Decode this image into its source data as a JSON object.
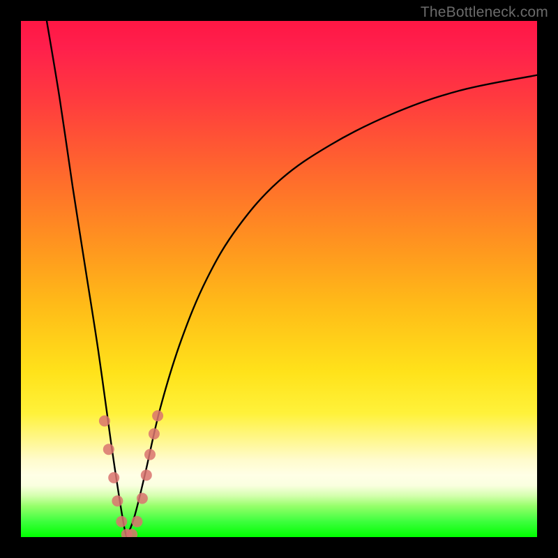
{
  "watermark": "TheBottleneck.com",
  "chart_data": {
    "type": "line",
    "title": "",
    "xlabel": "",
    "ylabel": "",
    "xlim": [
      0,
      100
    ],
    "ylim": [
      0,
      100
    ],
    "grid": false,
    "background": "vertical gradient red→orange→yellow→pale→green (bottleneck severity scale; green at bottom = no bottleneck)",
    "series": [
      {
        "name": "left-branch",
        "x": [
          5,
          7.5,
          10,
          12.5,
          15,
          17.5,
          19,
          20,
          20.5
        ],
        "y": [
          100,
          85,
          68,
          52,
          36,
          18,
          8,
          2,
          0
        ]
      },
      {
        "name": "right-branch",
        "x": [
          20.5,
          22,
          24,
          27,
          31,
          36,
          42,
          50,
          60,
          72,
          85,
          100
        ],
        "y": [
          0,
          4,
          12,
          25,
          38,
          50,
          60,
          69,
          76,
          82,
          86.5,
          89.5
        ]
      }
    ],
    "markers": {
      "name": "near-minimum-cluster",
      "color": "#d9736f",
      "radius_px": 8,
      "points_xy": [
        [
          16.2,
          22.5
        ],
        [
          17.0,
          17.0
        ],
        [
          18.0,
          11.5
        ],
        [
          18.7,
          7.0
        ],
        [
          19.5,
          3.0
        ],
        [
          20.5,
          0.5
        ],
        [
          21.5,
          0.5
        ],
        [
          22.5,
          3.0
        ],
        [
          23.5,
          7.5
        ],
        [
          24.3,
          12.0
        ],
        [
          25.0,
          16.0
        ],
        [
          25.8,
          20.0
        ],
        [
          26.5,
          23.5
        ]
      ]
    },
    "notes": "No axis ticks or labels rendered in the original image; the plot occupies a 740×740 px area inside a 30 px black frame on all sides of the 800×800 canvas. Values above are visual estimates on a 0–100 scale in each axis."
  }
}
